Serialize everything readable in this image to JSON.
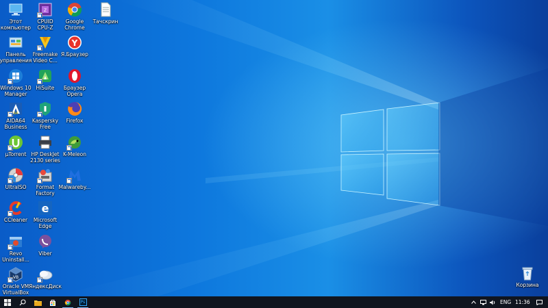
{
  "desktop": {
    "icons": [
      {
        "id": "this-pc",
        "label": "Этот\nкомпьютер",
        "icon": "computer-icon"
      },
      {
        "id": "control-panel",
        "label": "Панель\nуправления",
        "icon": "control-panel-icon"
      },
      {
        "id": "w10-manager",
        "label": "Windows 10\nManager",
        "icon": "windows10-manager-icon"
      },
      {
        "id": "aida64",
        "label": "AIDA64\nBusiness",
        "icon": "aida64-icon"
      },
      {
        "id": "utorrent",
        "label": "µTorrent",
        "icon": "utorrent-icon"
      },
      {
        "id": "ultraiso",
        "label": "UltraISO",
        "icon": "ultraiso-icon"
      },
      {
        "id": "ccleaner",
        "label": "CCleaner",
        "icon": "ccleaner-icon"
      },
      {
        "id": "revo",
        "label": "Revo\nUninstall...",
        "icon": "revo-uninstaller-icon"
      },
      {
        "id": "virtualbox",
        "label": "Oracle VM\nVirtualBox",
        "icon": "virtualbox-icon"
      },
      {
        "id": "cpuz",
        "label": "CPUID\nCPU-Z",
        "icon": "cpuz-icon"
      },
      {
        "id": "freemake",
        "label": "Freemake\nVideo C...",
        "icon": "freemake-icon"
      },
      {
        "id": "hisuite",
        "label": "HiSuite",
        "icon": "hisuite-icon"
      },
      {
        "id": "kaspersky",
        "label": "Kaspersky\nFree",
        "icon": "kaspersky-icon"
      },
      {
        "id": "hp-deskjet",
        "label": "HP DeskJet\n2130 series",
        "icon": "hp-printer-icon"
      },
      {
        "id": "format-factory",
        "label": "Format\nFactory",
        "icon": "format-factory-icon"
      },
      {
        "id": "edge",
        "label": "Microsoft\nEdge",
        "icon": "edge-icon"
      },
      {
        "id": "viber",
        "label": "Viber",
        "icon": "viber-icon"
      },
      {
        "id": "yandex-disk",
        "label": "ЯндексДиск",
        "icon": "yandex-disk-icon"
      },
      {
        "id": "chrome",
        "label": "Google\nChrome",
        "icon": "chrome-icon"
      },
      {
        "id": "yandex-browser",
        "label": "Я.Браузер",
        "icon": "yandex-browser-icon"
      },
      {
        "id": "opera",
        "label": "Браузер\nOpera",
        "icon": "opera-icon"
      },
      {
        "id": "firefox",
        "label": "Firefox",
        "icon": "firefox-icon"
      },
      {
        "id": "k-meleon",
        "label": "K-Meleon",
        "icon": "k-meleon-icon"
      },
      {
        "id": "malwarebytes",
        "label": "Malwareby...",
        "icon": "malwarebytes-icon"
      },
      {
        "id": "tachskrin",
        "label": "Тачскрин",
        "icon": "text-file-icon"
      },
      {
        "id": "recycle-bin",
        "label": "Корзина",
        "icon": "recycle-bin-icon"
      }
    ]
  },
  "taskbar": {
    "start_icon": "windows-start-icon",
    "search_icon": "search-icon",
    "pinned": [
      "file-explorer-icon",
      "store-icon",
      "chrome-icon",
      "photoshop-icon"
    ],
    "photoshop_label": "Ps",
    "tray": {
      "language": "ENG",
      "time": "11:36",
      "icons": [
        "chevron-up-icon",
        "network-icon",
        "volume-icon",
        "notification-icon"
      ]
    }
  },
  "colors": {
    "taskbar": "#10151f",
    "accent": "#7ab6f5",
    "wallpaper": "#0d77dd"
  }
}
